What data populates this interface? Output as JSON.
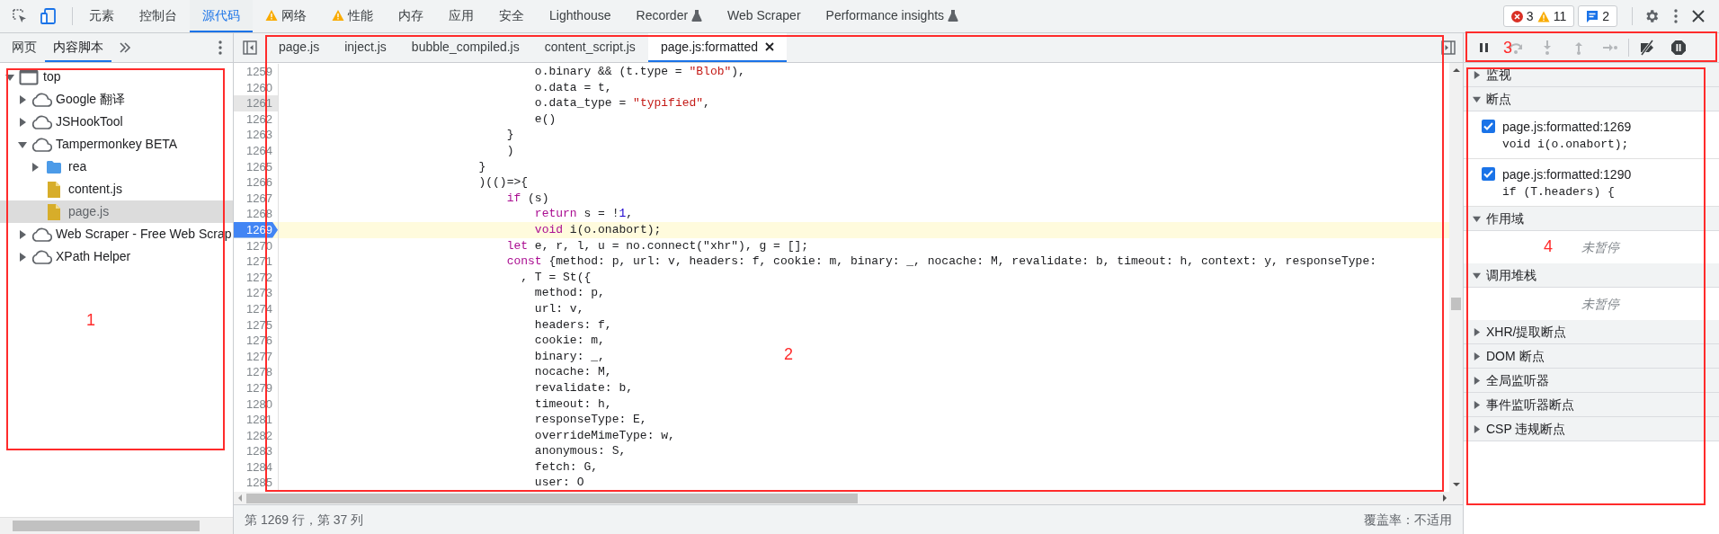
{
  "toolbar": {
    "tabs": [
      {
        "label": "元素",
        "selected": false
      },
      {
        "label": "控制台",
        "selected": false
      },
      {
        "label": "源代码",
        "selected": true
      },
      {
        "label": "网络",
        "selected": false,
        "warning": true
      },
      {
        "label": "性能",
        "selected": false,
        "warning": true
      },
      {
        "label": "内存",
        "selected": false
      },
      {
        "label": "应用",
        "selected": false
      },
      {
        "label": "安全",
        "selected": false
      },
      {
        "label": "Lighthouse",
        "selected": false
      },
      {
        "label": "Recorder",
        "selected": false,
        "experimental": true
      },
      {
        "label": "Web Scraper",
        "selected": false
      },
      {
        "label": "Performance insights",
        "selected": false,
        "experimental": true
      }
    ],
    "errors": "3",
    "warnings": "11",
    "messages": "2"
  },
  "navigator": {
    "tabs": [
      {
        "label": "网页",
        "selected": false
      },
      {
        "label": "内容脚本",
        "selected": true
      }
    ],
    "tree": [
      {
        "label": "top",
        "kind": "frame",
        "expanded": true,
        "selected": false,
        "children": [
          {
            "label": "Google 翻译",
            "kind": "cloud",
            "expanded": false,
            "selected": false
          },
          {
            "label": "JSHookTool",
            "kind": "cloud",
            "expanded": false,
            "selected": false
          },
          {
            "label": "Tampermonkey BETA",
            "kind": "cloud",
            "expanded": true,
            "selected": false,
            "children": [
              {
                "label": "rea",
                "kind": "folder",
                "expanded": false,
                "selected": false
              },
              {
                "label": "content.js",
                "kind": "file",
                "selected": false
              },
              {
                "label": "page.js",
                "kind": "file",
                "selected": true
              }
            ]
          },
          {
            "label": "Web Scraper - Free Web Scrap",
            "kind": "cloud",
            "expanded": false,
            "selected": false
          },
          {
            "label": "XPath Helper",
            "kind": "cloud",
            "expanded": false,
            "selected": false
          }
        ]
      }
    ]
  },
  "editor": {
    "tabs": [
      {
        "label": "page.js",
        "selected": false
      },
      {
        "label": "inject.js",
        "selected": false
      },
      {
        "label": "bubble_compiled.js",
        "selected": false
      },
      {
        "label": "content_script.js",
        "selected": false
      },
      {
        "label": "page.js:formatted",
        "selected": true,
        "closable": true
      }
    ],
    "lines": [
      {
        "number": "1259",
        "breakpoint": false,
        "cursor": false,
        "hovered": false,
        "tokens": [
          {
            "text": "                                    o.binary && (t.type = ",
            "kind": "plain"
          },
          {
            "text": "\"Blob\"",
            "kind": "string"
          },
          {
            "text": "),",
            "kind": "plain"
          }
        ]
      },
      {
        "number": "1260",
        "breakpoint": false,
        "cursor": false,
        "hovered": false,
        "tokens": [
          {
            "text": "                                    o.data = t,",
            "kind": "plain"
          }
        ]
      },
      {
        "number": "1261",
        "breakpoint": false,
        "cursor": false,
        "hovered": true,
        "tokens": [
          {
            "text": "                                    o.data_type = ",
            "kind": "plain"
          },
          {
            "text": "\"typified\"",
            "kind": "string"
          },
          {
            "text": ",",
            "kind": "plain"
          }
        ]
      },
      {
        "number": "1262",
        "breakpoint": false,
        "cursor": false,
        "hovered": false,
        "tokens": [
          {
            "text": "                                    e()",
            "kind": "plain"
          }
        ]
      },
      {
        "number": "1263",
        "breakpoint": false,
        "cursor": false,
        "hovered": false,
        "tokens": [
          {
            "text": "                                }",
            "kind": "plain"
          }
        ]
      },
      {
        "number": "1264",
        "breakpoint": false,
        "cursor": false,
        "hovered": false,
        "tokens": [
          {
            "text": "                                )",
            "kind": "plain"
          }
        ]
      },
      {
        "number": "1265",
        "breakpoint": false,
        "cursor": false,
        "hovered": false,
        "tokens": [
          {
            "text": "                            }",
            "kind": "plain"
          }
        ]
      },
      {
        "number": "1266",
        "breakpoint": false,
        "cursor": false,
        "hovered": false,
        "tokens": [
          {
            "text": "                            )(()=>{",
            "kind": "plain"
          }
        ]
      },
      {
        "number": "1267",
        "breakpoint": false,
        "cursor": false,
        "hovered": false,
        "tokens": [
          {
            "text": "                                if",
            "kind": "keyword"
          },
          {
            "text": " (s)",
            "kind": "plain"
          }
        ]
      },
      {
        "number": "1268",
        "breakpoint": false,
        "cursor": false,
        "hovered": false,
        "tokens": [
          {
            "text": "                                    return",
            "kind": "keyword"
          },
          {
            "text": " s = !",
            "kind": "plain"
          },
          {
            "text": "1",
            "kind": "number"
          },
          {
            "text": ",",
            "kind": "plain"
          }
        ]
      },
      {
        "number": "1269",
        "breakpoint": true,
        "cursor": true,
        "hovered": false,
        "tokens": [
          {
            "text": "                                    void",
            "kind": "keyword"
          },
          {
            "text": " i(o.onabort);",
            "kind": "plain"
          }
        ]
      },
      {
        "number": "1270",
        "breakpoint": false,
        "cursor": false,
        "hovered": false,
        "tokens": [
          {
            "text": "                                let",
            "kind": "keyword"
          },
          {
            "text": " e, r, l, u = no.connect(\"xhr\"), g = [];",
            "kind": "plain"
          }
        ]
      },
      {
        "number": "1271",
        "breakpoint": false,
        "cursor": false,
        "hovered": false,
        "tokens": [
          {
            "text": "                                const",
            "kind": "keyword"
          },
          {
            "text": " {method: p, url: v, headers: f, cookie: m, binary: _, nocache: M, revalidate: b, timeout: h, context: y, responseType:",
            "kind": "plain"
          }
        ]
      },
      {
        "number": "1272",
        "breakpoint": false,
        "cursor": false,
        "hovered": false,
        "tokens": [
          {
            "text": "                                  , T = St({",
            "kind": "plain"
          }
        ]
      },
      {
        "number": "1273",
        "breakpoint": false,
        "cursor": false,
        "hovered": false,
        "tokens": [
          {
            "text": "                                    method: p,",
            "kind": "plain"
          }
        ]
      },
      {
        "number": "1274",
        "breakpoint": false,
        "cursor": false,
        "hovered": false,
        "tokens": [
          {
            "text": "                                    url: v,",
            "kind": "plain"
          }
        ]
      },
      {
        "number": "1275",
        "breakpoint": false,
        "cursor": false,
        "hovered": false,
        "tokens": [
          {
            "text": "                                    headers: f,",
            "kind": "plain"
          }
        ]
      },
      {
        "number": "1276",
        "breakpoint": false,
        "cursor": false,
        "hovered": false,
        "tokens": [
          {
            "text": "                                    cookie: m,",
            "kind": "plain"
          }
        ]
      },
      {
        "number": "1277",
        "breakpoint": false,
        "cursor": false,
        "hovered": false,
        "tokens": [
          {
            "text": "                                    binary: _,",
            "kind": "plain"
          }
        ]
      },
      {
        "number": "1278",
        "breakpoint": false,
        "cursor": false,
        "hovered": false,
        "tokens": [
          {
            "text": "                                    nocache: M,",
            "kind": "plain"
          }
        ]
      },
      {
        "number": "1279",
        "breakpoint": false,
        "cursor": false,
        "hovered": false,
        "tokens": [
          {
            "text": "                                    revalidate: b,",
            "kind": "plain"
          }
        ]
      },
      {
        "number": "1280",
        "breakpoint": false,
        "cursor": false,
        "hovered": false,
        "tokens": [
          {
            "text": "                                    timeout: h,",
            "kind": "plain"
          }
        ]
      },
      {
        "number": "1281",
        "breakpoint": false,
        "cursor": false,
        "hovered": false,
        "tokens": [
          {
            "text": "                                    responseType: E,",
            "kind": "plain"
          }
        ]
      },
      {
        "number": "1282",
        "breakpoint": false,
        "cursor": false,
        "hovered": false,
        "tokens": [
          {
            "text": "                                    overrideMimeType: w,",
            "kind": "plain"
          }
        ]
      },
      {
        "number": "1283",
        "breakpoint": false,
        "cursor": false,
        "hovered": false,
        "tokens": [
          {
            "text": "                                    anonymous: S,",
            "kind": "plain"
          }
        ]
      },
      {
        "number": "1284",
        "breakpoint": false,
        "cursor": false,
        "hovered": false,
        "tokens": [
          {
            "text": "                                    fetch: G,",
            "kind": "plain"
          }
        ]
      },
      {
        "number": "1285",
        "breakpoint": false,
        "cursor": false,
        "hovered": false,
        "tokens": [
          {
            "text": "                                    user: O",
            "kind": "plain"
          }
        ]
      }
    ],
    "status": {
      "position": "第 1269 行，第 37 列",
      "coverage": "覆盖率：不适用"
    }
  },
  "debugger": {
    "controls": [
      {
        "kind": "pause",
        "disabled": false
      },
      {
        "kind": "step-over",
        "disabled": true
      },
      {
        "kind": "step-into",
        "disabled": true
      },
      {
        "kind": "step-out",
        "disabled": true
      },
      {
        "kind": "step",
        "disabled": true
      },
      {
        "kind": "deactivate-breakpoints",
        "disabled": false
      },
      {
        "kind": "pause-on-exceptions",
        "disabled": false
      }
    ],
    "sections": [
      {
        "title": "监视",
        "expanded": false
      },
      {
        "title": "断点",
        "expanded": true,
        "breakpoints": [
          {
            "location": "page.js:formatted:1269",
            "code": "void i(o.onabort);",
            "checked": true
          },
          {
            "location": "page.js:formatted:1290",
            "code": "if (T.headers) {",
            "checked": true
          }
        ]
      },
      {
        "title": "作用域",
        "expanded": true,
        "message": "未暂停"
      },
      {
        "title": "调用堆栈",
        "expanded": true,
        "message": "未暂停"
      },
      {
        "title": "XHR/提取断点",
        "expanded": false
      },
      {
        "title": "DOM 断点",
        "expanded": false
      },
      {
        "title": "全局监听器",
        "expanded": false
      },
      {
        "title": "事件监听器断点",
        "expanded": false
      },
      {
        "title": "CSP 违规断点",
        "expanded": false
      }
    ]
  },
  "annotations": [
    {
      "label": "1"
    },
    {
      "label": "2"
    },
    {
      "label": "3"
    },
    {
      "label": "4"
    }
  ]
}
